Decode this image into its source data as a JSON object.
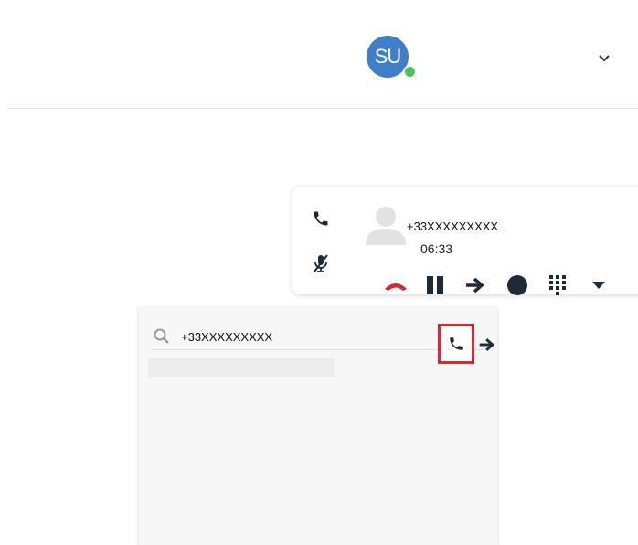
{
  "header": {
    "avatar_initials": "SU",
    "status_color": "#4cc35a",
    "avatar_color": "#3f7fc8",
    "dropdown_icon": "chevron-down-icon"
  },
  "call": {
    "number": "+33XXXXXXXXX",
    "duration": "06:33",
    "side_icons": [
      "phone-icon",
      "microphone-muted-icon"
    ],
    "controls": [
      "hangup-icon",
      "pause-icon",
      "transfer-arrow-icon",
      "record-icon",
      "dialpad-icon",
      "more-caret-icon"
    ],
    "hangup_color": "#d8262e"
  },
  "dialer": {
    "value": "+33XXXXXXXXX",
    "search_icon": "search-icon",
    "call_button_icon": "phone-icon",
    "transfer_icon": "arrow-right-icon",
    "highlight_color": "#e3262e"
  }
}
